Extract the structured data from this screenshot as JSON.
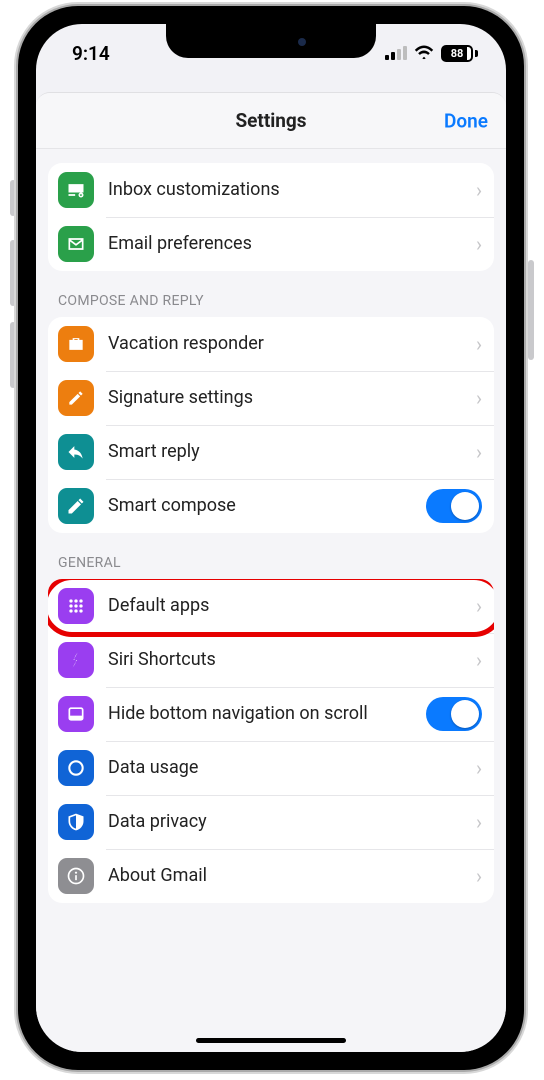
{
  "status": {
    "time": "9:14",
    "battery": "88"
  },
  "nav": {
    "title": "Settings",
    "done": "Done"
  },
  "first_group": {
    "items": [
      {
        "label": "Inbox customizations",
        "icon": "inbox-settings-icon",
        "color": "#2aa04a"
      },
      {
        "label": "Email preferences",
        "icon": "email-icon",
        "color": "#2aa04a"
      }
    ]
  },
  "compose_section": {
    "header": "COMPOSE AND REPLY",
    "items": [
      {
        "label": "Vacation responder",
        "icon": "suitcase-icon",
        "color": "#ed7e0f",
        "type": "link"
      },
      {
        "label": "Signature settings",
        "icon": "pen-icon",
        "color": "#ed7e0f",
        "type": "link"
      },
      {
        "label": "Smart reply",
        "icon": "reply-icon",
        "color": "#0e8f93",
        "type": "link"
      },
      {
        "label": "Smart compose",
        "icon": "pencil-icon",
        "color": "#0e8f93",
        "type": "toggle",
        "on": true
      }
    ]
  },
  "general_section": {
    "header": "GENERAL",
    "items": [
      {
        "label": "Default apps",
        "icon": "grid-icon",
        "color": "#9a3ef0",
        "type": "link",
        "highlighted": true
      },
      {
        "label": "Siri Shortcuts",
        "icon": "shortcut-icon",
        "color": "#9a3ef0",
        "type": "link"
      },
      {
        "label": "Hide bottom navigation on scroll",
        "icon": "nav-icon",
        "color": "#9a3ef0",
        "type": "toggle",
        "on": true
      },
      {
        "label": "Data usage",
        "icon": "circle-icon",
        "color": "#1064d6",
        "type": "link"
      },
      {
        "label": "Data privacy",
        "icon": "shield-icon",
        "color": "#1064d6",
        "type": "link"
      },
      {
        "label": "About Gmail",
        "icon": "info-icon",
        "color": "#8e8e92",
        "type": "link"
      }
    ]
  }
}
